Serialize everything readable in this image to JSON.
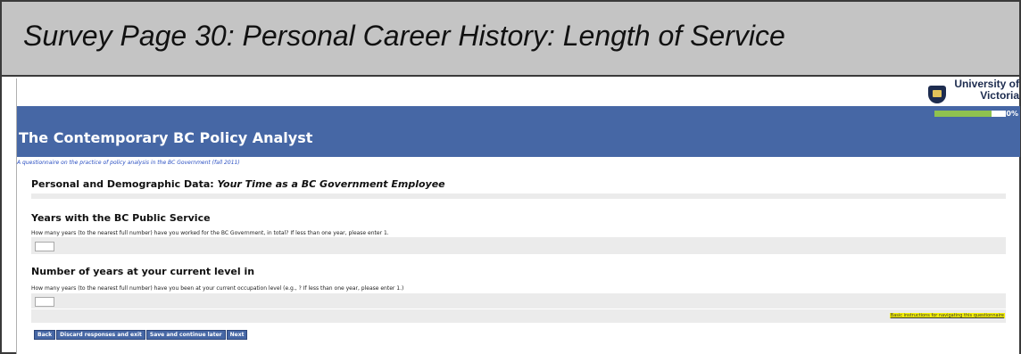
{
  "slide": {
    "title": "Survey Page 30: Personal Career History: Length of Service"
  },
  "header": {
    "logo_text": "University of Victoria",
    "banner_title": "The Contemporary BC Policy Analyst",
    "progress": {
      "value": 0.8,
      "label": "80%",
      "color": "#8fc24f"
    },
    "subtitle": "A questionnaire on the practice of policy analysis in the BC Government (fall 2011)"
  },
  "section": {
    "prefix": "Personal and Demographic Data: ",
    "emphasis": "Your Time as a BC Government Employee"
  },
  "questions": [
    {
      "title": "Years with the BC Public Service",
      "text": "How many years (to the nearest full number) have you worked for the BC Government, in total? If less than one year, please enter 1.",
      "value": ""
    },
    {
      "title": "Number of years at your current level in",
      "text": "How many years (to the nearest full number) have you been at your current occupation level (e.g., ? If less than one year, please enter 1.)",
      "value": ""
    }
  ],
  "nav_link": "Basic instructions for navigating this questionnaire",
  "buttons": {
    "back": "Back",
    "discard": "Discard responses and exit",
    "save": "Save and continue later",
    "next": "Next"
  },
  "colors": {
    "banner": "#4667a5",
    "slide_header": "#c4c4c4",
    "band": "#ebebeb",
    "nav_link_highlight": "#f5f005"
  }
}
